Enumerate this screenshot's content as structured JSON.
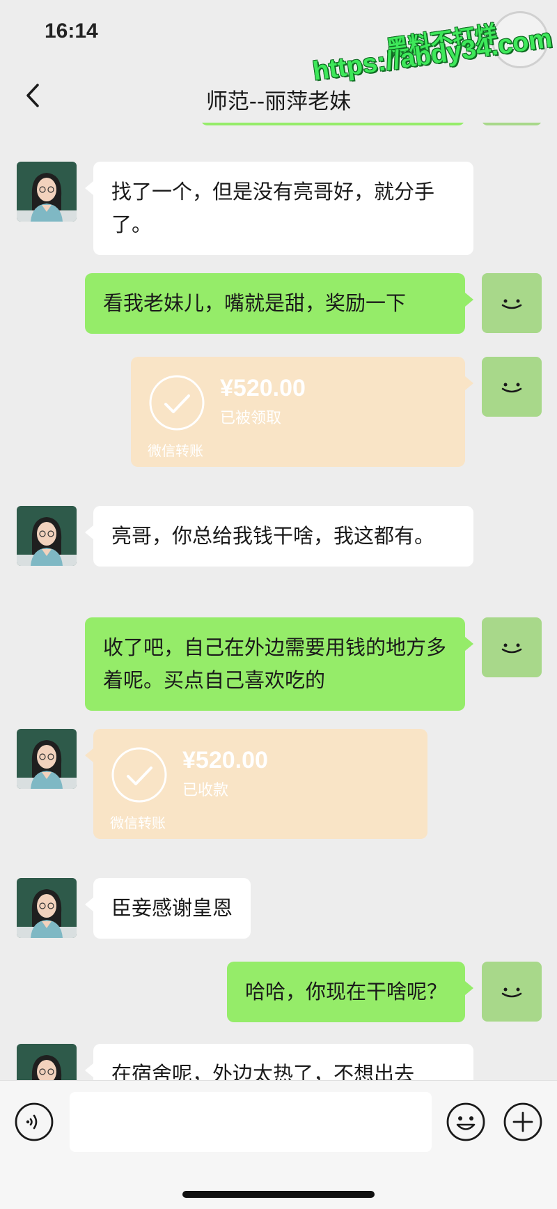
{
  "status_bar": {
    "time": "16:14"
  },
  "watermark": {
    "line1": "黑料不打烊",
    "line2": "https://abdy34.com"
  },
  "header": {
    "title": "师范--丽萍老妹"
  },
  "messages": [
    {
      "from": "contact",
      "type": "text",
      "text": "找了一个，但是没有亮哥好，就分手了。"
    },
    {
      "from": "me",
      "type": "text",
      "text": "看我老妹儿，嘴就是甜，奖励一下"
    },
    {
      "from": "me",
      "type": "transfer",
      "amount": "¥520.00",
      "status": "已被领取",
      "label": "微信转账"
    },
    {
      "from": "contact",
      "type": "text",
      "text": "亮哥，你总给我钱干啥，我这都有。"
    },
    {
      "from": "me",
      "type": "text",
      "text": "收了吧，自己在外边需要用钱的地方多着呢。买点自己喜欢吃的"
    },
    {
      "from": "contact",
      "type": "transfer",
      "amount": "¥520.00",
      "status": "已收款",
      "label": "微信转账"
    },
    {
      "from": "contact",
      "type": "text",
      "text": "臣妾感谢皇恩"
    },
    {
      "from": "me",
      "type": "text",
      "text": "哈哈，你现在干啥呢？"
    },
    {
      "from": "contact",
      "type": "text",
      "text": "在宿舍呢，外边太热了，不想出去"
    }
  ],
  "input_bar": {
    "placeholder": ""
  },
  "colors": {
    "background": "#ededed",
    "out_bubble": "#95ec69",
    "in_bubble": "#ffffff",
    "transfer": "#f9e4c6"
  },
  "icons": [
    "back-arrow-icon",
    "voice-icon",
    "emoji-icon",
    "plus-icon",
    "checkmark-icon"
  ]
}
